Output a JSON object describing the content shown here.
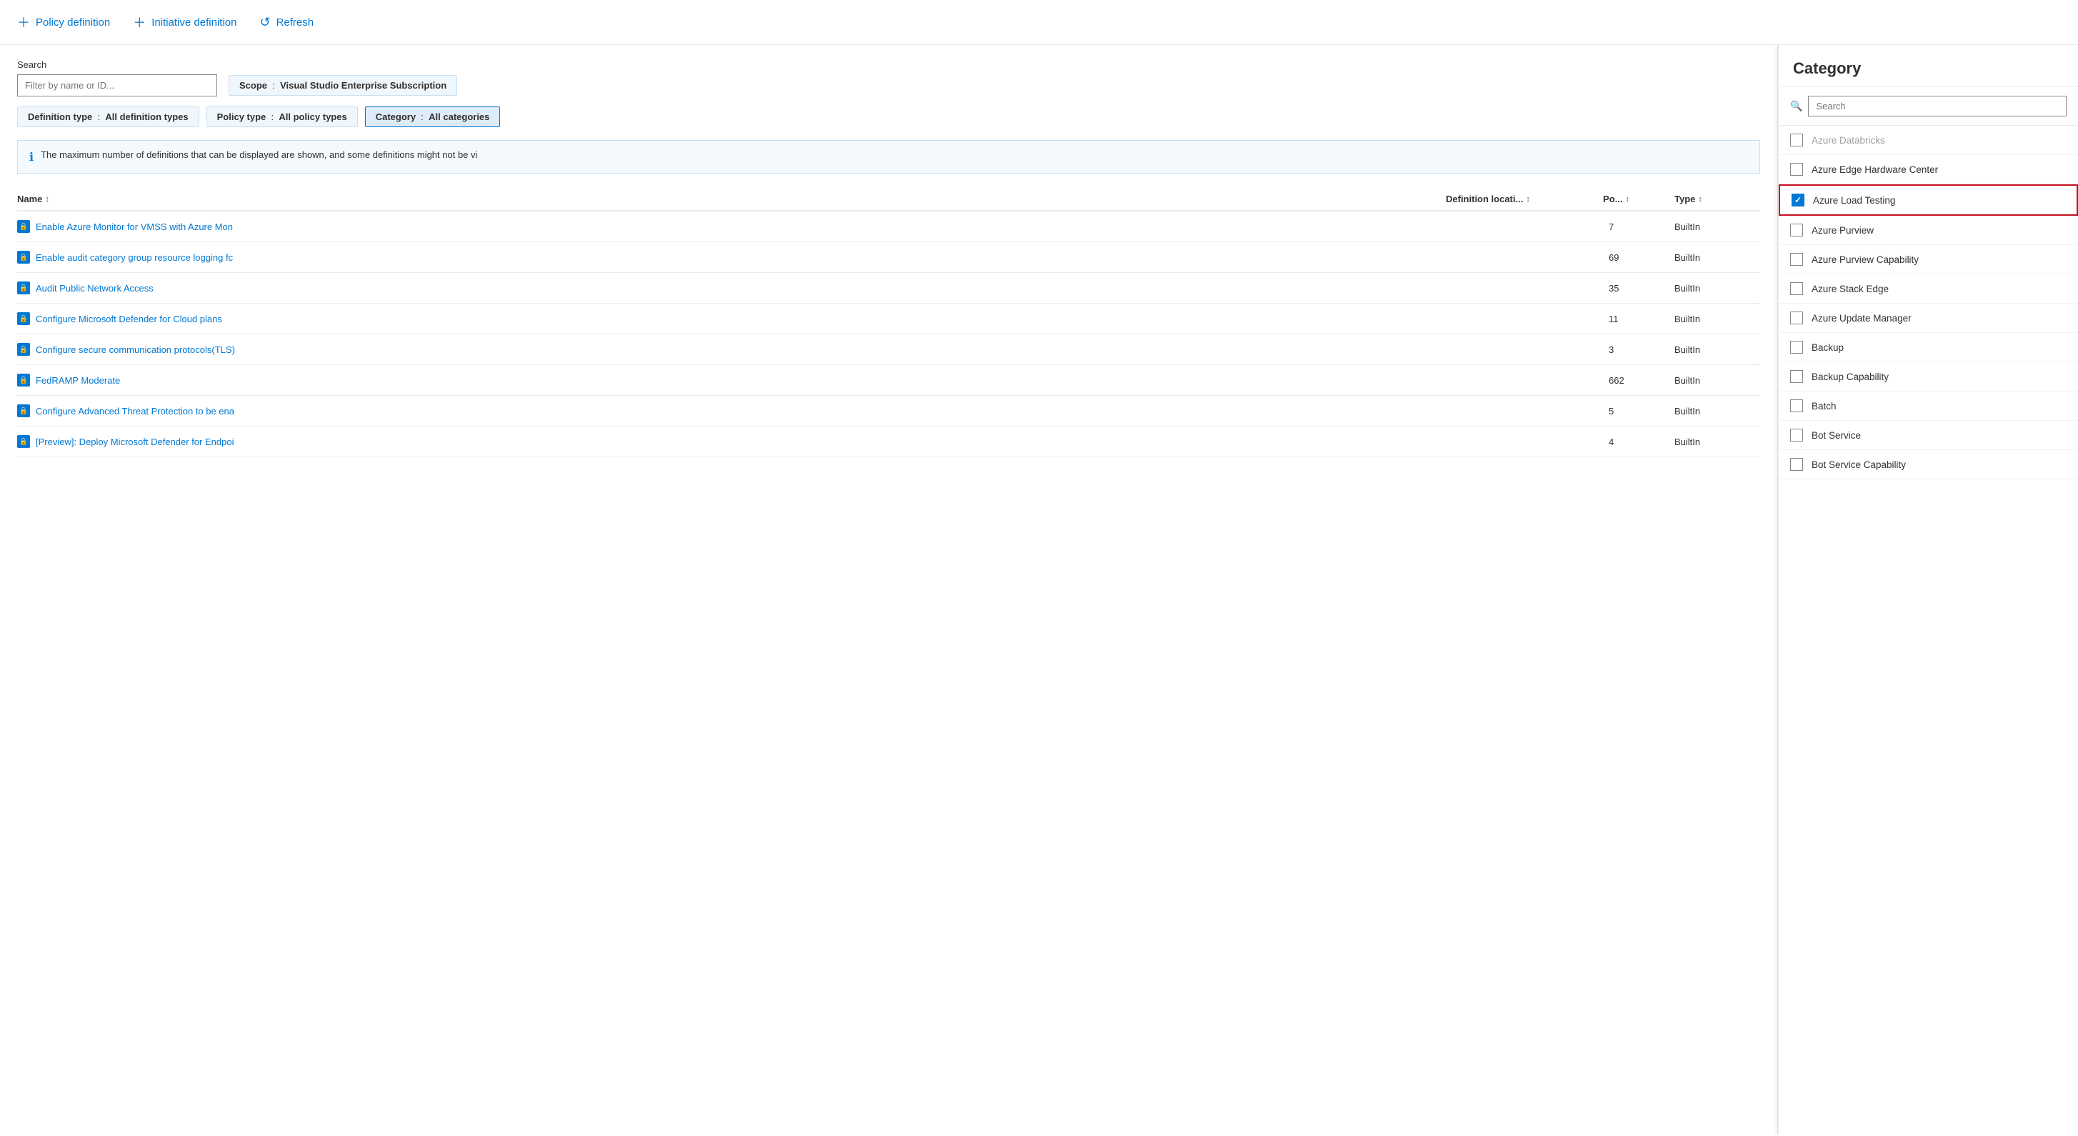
{
  "toolbar": {
    "policy_definition_label": "Policy definition",
    "initiative_definition_label": "Initiative definition",
    "refresh_label": "Refresh"
  },
  "search": {
    "label": "Search",
    "placeholder": "Filter by name or ID...",
    "scope_label": "Scope",
    "scope_value": "Visual Studio Enterprise Subscription"
  },
  "filters": {
    "definition_type_label": "Definition type",
    "definition_type_value": "All definition types",
    "policy_type_label": "Policy type",
    "policy_type_value": "All policy types",
    "category_label": "Category",
    "category_value": "All categories"
  },
  "info_bar": {
    "message": "The maximum number of definitions that can be displayed are shown, and some definitions might not be vi"
  },
  "table": {
    "columns": [
      {
        "label": "Name"
      },
      {
        "label": "Definition locati..."
      },
      {
        "label": "Po..."
      },
      {
        "label": "Type"
      }
    ],
    "rows": [
      {
        "name": "Enable Azure Monitor for VMSS with Azure Mon",
        "location": "",
        "policies": "7",
        "type": "BuiltIn"
      },
      {
        "name": "Enable audit category group resource logging fc",
        "location": "",
        "policies": "69",
        "type": "BuiltIn"
      },
      {
        "name": "Audit Public Network Access",
        "location": "",
        "policies": "35",
        "type": "BuiltIn"
      },
      {
        "name": "Configure Microsoft Defender for Cloud plans",
        "location": "",
        "policies": "11",
        "type": "BuiltIn"
      },
      {
        "name": "Configure secure communication protocols(TLS)",
        "location": "",
        "policies": "3",
        "type": "BuiltIn"
      },
      {
        "name": "FedRAMP Moderate",
        "location": "",
        "policies": "662",
        "type": "BuiltIn"
      },
      {
        "name": "Configure Advanced Threat Protection to be ena",
        "location": "",
        "policies": "5",
        "type": "BuiltIn"
      },
      {
        "name": "[Preview]: Deploy Microsoft Defender for Endpoi",
        "location": "",
        "policies": "4",
        "type": "BuiltIn"
      }
    ]
  },
  "category_panel": {
    "title": "Category",
    "search_placeholder": "Search",
    "items": [
      {
        "label": "Azure Databricks",
        "checked": false,
        "faded": true
      },
      {
        "label": "Azure Edge Hardware Center",
        "checked": false
      },
      {
        "label": "Azure Load Testing",
        "checked": true,
        "highlighted": true
      },
      {
        "label": "Azure Purview",
        "checked": false
      },
      {
        "label": "Azure Purview Capability",
        "checked": false
      },
      {
        "label": "Azure Stack Edge",
        "checked": false
      },
      {
        "label": "Azure Update Manager",
        "checked": false
      },
      {
        "label": "Backup",
        "checked": false
      },
      {
        "label": "Backup Capability",
        "checked": false
      },
      {
        "label": "Batch",
        "checked": false
      },
      {
        "label": "Bot Service",
        "checked": false
      },
      {
        "label": "Bot Service Capability",
        "checked": false
      }
    ]
  }
}
